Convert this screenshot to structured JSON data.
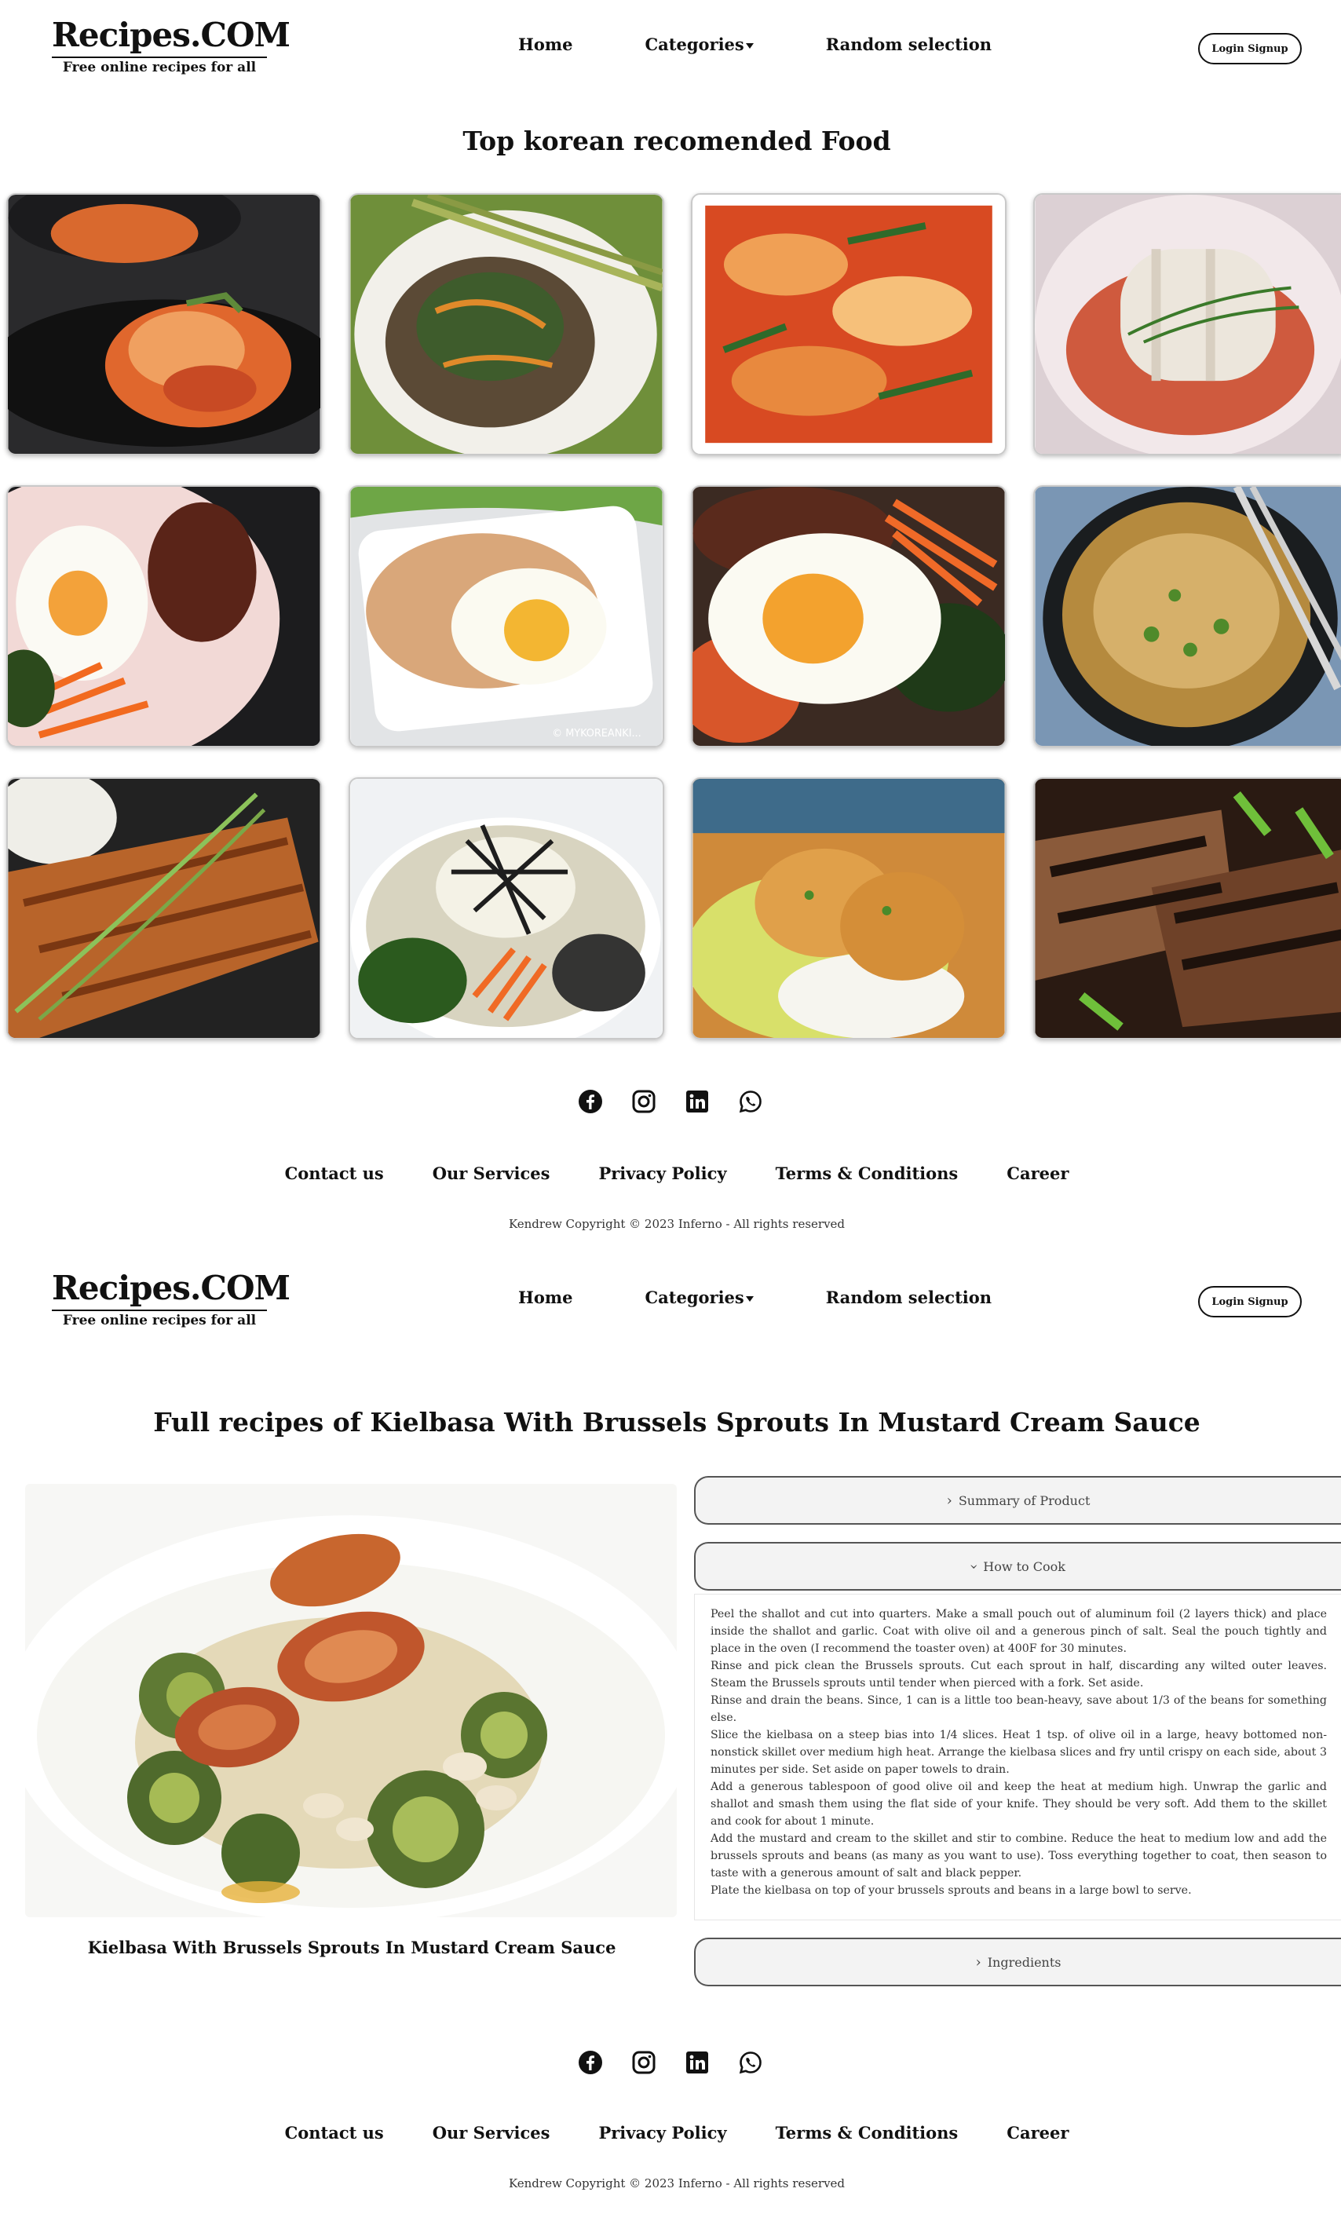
{
  "site": {
    "brand_title": "Recipes.COM",
    "brand_tagline": "Free online recipes for all",
    "nav": {
      "home": "Home",
      "categories": "Categories",
      "random": "Random selection"
    },
    "login": "Login Signup"
  },
  "home": {
    "heading": "Top korean recomended Food",
    "cards": [
      {
        "icon": "kimchi-plate"
      },
      {
        "icon": "japchae-noodles"
      },
      {
        "icon": "kimchi-closeup"
      },
      {
        "icon": "cabbage-kimchi"
      },
      {
        "icon": "bibimbap-egg"
      },
      {
        "icon": "egg-rice-dish"
      },
      {
        "icon": "bibimbap-beef-egg"
      },
      {
        "icon": "noodle-soup-bowl"
      },
      {
        "icon": "pork-cutlet"
      },
      {
        "icon": "bibimbap-seaweed"
      },
      {
        "icon": "fried-chicken-rice"
      },
      {
        "icon": "grilled-meat"
      }
    ],
    "watermark": "© MYKOREANKI..."
  },
  "social": [
    "facebook-icon",
    "instagram-icon",
    "linkedin-icon",
    "whatsapp-icon"
  ],
  "footer": {
    "links": [
      "Contact us",
      "Our Services",
      "Privacy Policy",
      "Terms & Conditions",
      "Career"
    ],
    "copyright": "Kendrew Copyright © 2023 Inferno - All rights reserved"
  },
  "recipe": {
    "heading": "Full recipes of Kielbasa With Brussels Sprouts In Mustard Cream Sauce",
    "caption": "Kielbasa With Brussels Sprouts In Mustard Cream Sauce",
    "summary_label": "Summary of Product",
    "how_label": "How to Cook",
    "ingredients_label": "Ingredients",
    "steps": [
      "Peel the shallot and cut into quarters. Make a small pouch out of aluminum foil (2 layers thick) and place inside the shallot and garlic. Coat with olive oil and a generous pinch of salt. Seal the pouch tightly and place in the oven (I recommend the toaster oven) at 400F for 30 minutes.",
      "Rinse and pick clean the Brussels sprouts. Cut each sprout in half, discarding any wilted outer leaves. Steam the Brussels sprouts until tender when pierced with a fork. Set aside.",
      "Rinse and drain the beans. Since, 1 can is a little too bean-heavy, save about 1/3 of the beans for something else.",
      "Slice the kielbasa on a steep bias into 1/4 slices. Heat 1 tsp. of olive oil in a large, heavy bottomed non-nonstick skillet over medium high heat. Arrange the kielbasa slices and fry until crispy on each side, about 3 minutes per side. Set aside on paper towels to drain.",
      "Add a generous tablespoon of good olive oil and keep the heat at medium high. Unwrap the garlic and shallot and smash them using the flat side of your knife. They should be very soft. Add them to the skillet and cook for about 1 minute.",
      "Add the mustard and cream to the skillet and stir to combine. Reduce the heat to medium low and add the brussels sprouts and beans (as many as you want to use). Toss everything together to coat, then season to taste with a generous amount of salt and black pepper.",
      "Plate the kielbasa on top of your brussels sprouts and beans in a large bowl to serve."
    ]
  }
}
